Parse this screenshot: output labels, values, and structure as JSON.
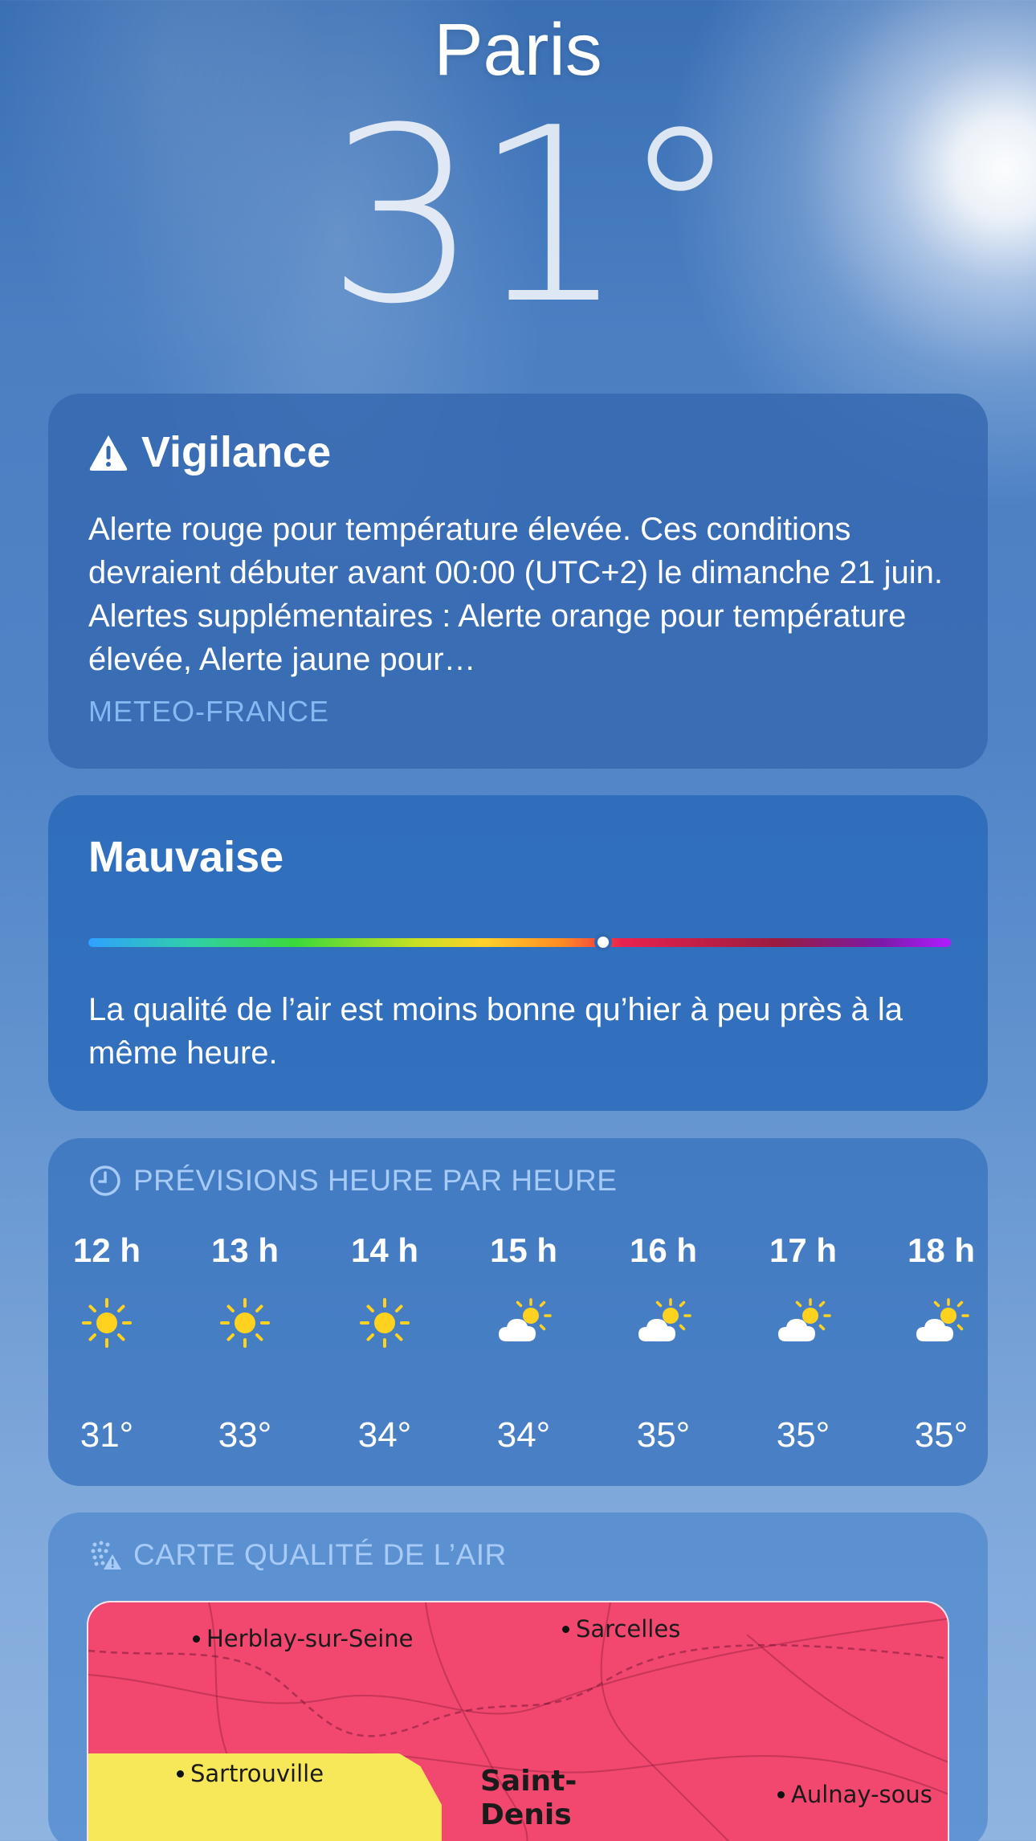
{
  "header": {
    "city": "Paris",
    "temperature": "31°"
  },
  "alert": {
    "title": "Vigilance",
    "icon": "warning-triangle-icon",
    "text": "Alerte rouge pour température élevée. Ces conditions devraient débuter avant 00:00 (UTC+2) le dimanche 21 juin. Alertes supplémentaires : Alerte orange pour température élevée, Alerte jaune pour…",
    "source": "METEO-FRANCE"
  },
  "air_quality": {
    "level": "Mauvaise",
    "indicator_position": 0.597,
    "description": "La qualité de l’air est moins bonne qu’hier à peu près à la même heure.",
    "colors": [
      "#2fa1ff",
      "#3bd83b",
      "#ffd02a",
      "#ff8a24",
      "#e8224e",
      "#9a1c40",
      "#b01cff"
    ]
  },
  "hourly": {
    "header": "PRÉVISIONS HEURE PAR HEURE",
    "icon": "clock-icon",
    "items": [
      {
        "hour": "12 h",
        "icon": "sun-icon",
        "temp": "31°"
      },
      {
        "hour": "13 h",
        "icon": "sun-icon",
        "temp": "33°"
      },
      {
        "hour": "14 h",
        "icon": "sun-icon",
        "temp": "34°"
      },
      {
        "hour": "15 h",
        "icon": "partly-cloudy-icon",
        "temp": "34°"
      },
      {
        "hour": "16 h",
        "icon": "partly-cloudy-icon",
        "temp": "35°"
      },
      {
        "hour": "17 h",
        "icon": "partly-cloudy-icon",
        "temp": "35°"
      },
      {
        "hour": "18 h",
        "icon": "partly-cloudy-icon",
        "temp": "35°"
      }
    ]
  },
  "map": {
    "header": "CARTE QUALITÉ DE L’AIR",
    "icon": "air-quality-map-icon",
    "places": {
      "herblay": "Herblay-sur-Seine",
      "sarcelles": "Sarcelles",
      "sartrouville": "Sartrouville",
      "saint_denis": "Saint-\nDenis",
      "aulnay": "Aulnay-sous"
    }
  }
}
